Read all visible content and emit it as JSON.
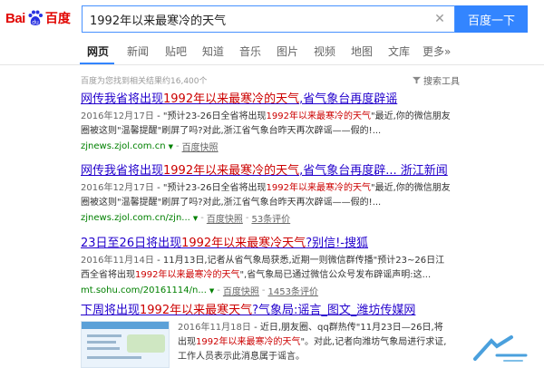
{
  "logo": {
    "text_left": "Bai",
    "text_right": "百度",
    "accent": "#e10602"
  },
  "search": {
    "value": "1992年以来最寒冷的天气",
    "button_label": "百度一下",
    "clear_icon": "close-icon"
  },
  "nav": {
    "items": [
      "网页",
      "新闻",
      "贴吧",
      "知道",
      "音乐",
      "图片",
      "视频",
      "地图",
      "文库",
      "更多»"
    ],
    "active": "网页"
  },
  "meta": {
    "result_count": "百度为您找到相关结果约16,400个",
    "tools_label": "搜索工具"
  },
  "results": [
    {
      "title_a": "网传我省将出现",
      "title_em": "1992年以来最寒冷的天气",
      "title_b": ",省气象台再度辟谣",
      "date": "2016年12月17日",
      "abs_a": " - \"预计23-26日全省将出现",
      "abs_em": "1992年以来最寒冷的天气",
      "abs_b": "\"最近,你的微信朋友圈被这则\"温馨提醒\"刷屏了吗?对此,浙江省气象台昨天再次辟谣——假的!...",
      "url": "zjnews.zjol.com.cn",
      "snapshot": "百度快照",
      "comments": ""
    },
    {
      "title_a": "网传我省将出现",
      "title_em": "1992年以来最寒冷的天气",
      "title_b": ",省气象台再度辟... 浙江新闻",
      "date": "2016年12月17日",
      "abs_a": " - \"预计23-26日全省将出现",
      "abs_em": "1992年以来最寒冷的天气",
      "abs_b": "\"最近,你的微信朋友圈被这则\"温馨提醒\"刷屏了吗?对此,浙江省气象台昨天再次辟谣——假的!...",
      "url": "zjnews.zjol.com.cn/zjn...",
      "snapshot": "百度快照",
      "comments": "53条评价"
    },
    {
      "title_a": "23日至26日将出现",
      "title_em": "1992年以来最寒冷天气",
      "title_b": "?别信!-搜狐",
      "date": "2016年11月14日",
      "abs_a": " - 11月13日,记者从省气象局获悉,近期一则微信群传播\"预计23~26日江西全省将出现",
      "abs_em": "1992年以来最寒冷的天气",
      "abs_b": "\",省气象局已通过微信公众号发布辟谣声明:这...",
      "url": "mt.sohu.com/20161114/n...",
      "snapshot": "百度快照",
      "comments": "1453条评价"
    },
    {
      "title_a": "下周将出现",
      "title_em": "1992年以来最寒天气",
      "title_b": "?气象局:谣言_图文_潍坊传媒网",
      "date": "2016年11月18日",
      "abs_a": " - 近日,朋友圈、qq群热传\"11月23日—26日,将出现",
      "abs_em": "1992年以来最寒冷的天气",
      "abs_b": "\"。对此,记者向潍坊气象局进行求证,工作人员表示此消息属于谣言。",
      "url": "",
      "snapshot": "",
      "comments": ""
    }
  ]
}
